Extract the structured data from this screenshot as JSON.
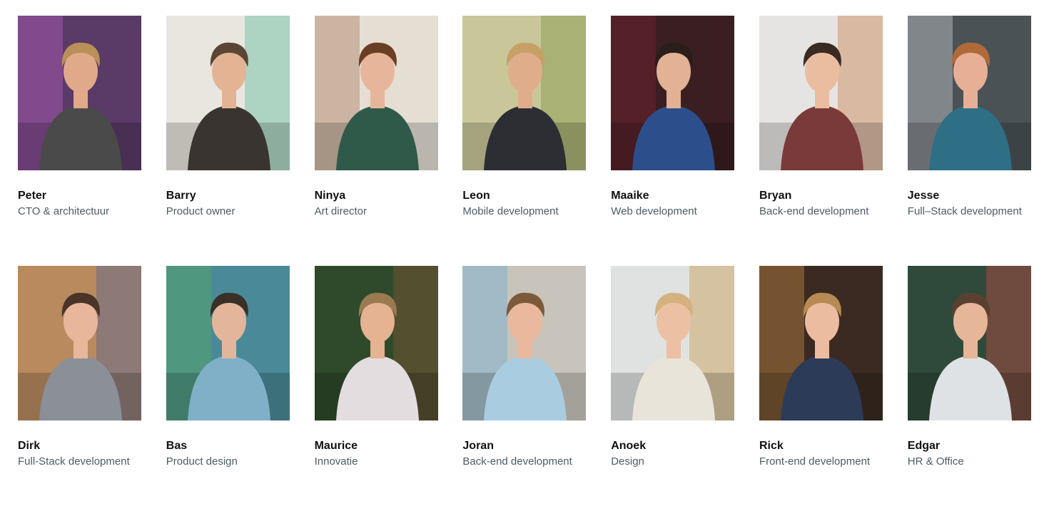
{
  "team": [
    {
      "name": "Peter",
      "role": "CTO & architectuur",
      "photo": {
        "bg": "#5a3a66",
        "accent": "#c86ad8",
        "shirt": "#4a4a4a",
        "skin": "#e0a98a",
        "hair": "#b89058"
      }
    },
    {
      "name": "Barry",
      "role": "Product owner",
      "photo": {
        "bg": "#e9e6df",
        "accent": "#3fae8c",
        "shirt": "#3a3430",
        "skin": "#e3b394",
        "hair": "#5b4534"
      }
    },
    {
      "name": "Ninya",
      "role": "Art director",
      "photo": {
        "bg": "#e5ded3",
        "accent": "#9c6a48",
        "shirt": "#2f5a4a",
        "skin": "#e7b69a",
        "hair": "#6a3e24"
      }
    },
    {
      "name": "Leon",
      "role": "Mobile development",
      "photo": {
        "bg": "#c9c79a",
        "accent": "#6c8a2e",
        "shirt": "#2c2e33",
        "skin": "#e0ad8a",
        "hair": "#c7a066"
      }
    },
    {
      "name": "Maaike",
      "role": "Web development",
      "photo": {
        "bg": "#3a1e22",
        "accent": "#8a2434",
        "shirt": "#2c4f8c",
        "skin": "#e3b194",
        "hair": "#2a1e1a"
      }
    },
    {
      "name": "Bryan",
      "role": "Back-end development",
      "photo": {
        "bg": "#e6e4e2",
        "accent": "#c46a2a",
        "shirt": "#7a3a3a",
        "skin": "#ebbda0",
        "hair": "#3a2a22"
      }
    },
    {
      "name": "Jesse",
      "role": "Full–Stack development",
      "photo": {
        "bg": "#4a5256",
        "accent": "#e7e9ea",
        "shirt": "#2f6f86",
        "skin": "#e7b096",
        "hair": "#b06a3a"
      }
    },
    {
      "name": "Dirk",
      "role": "Full-Stack development",
      "photo": {
        "bg": "#b88a5e",
        "accent": "#3c5aa0",
        "shirt": "#8a8f98",
        "skin": "#e8b69a",
        "hair": "#4a3428"
      }
    },
    {
      "name": "Bas",
      "role": "Product design",
      "photo": {
        "bg": "#4a8a98",
        "accent": "#5cae54",
        "shirt": "#7fb0c8",
        "skin": "#e3b69c",
        "hair": "#3a3028"
      }
    },
    {
      "name": "Maurice",
      "role": "Innovatie",
      "photo": {
        "bg": "#2e4a2a",
        "accent": "#9a5a3a",
        "shirt": "#e4dde0",
        "skin": "#e5b292",
        "hair": "#9a7a50"
      }
    },
    {
      "name": "Joran",
      "role": "Back-end development",
      "photo": {
        "bg": "#c8c4bc",
        "accent": "#59a8d8",
        "shirt": "#a9cce0",
        "skin": "#eab89c",
        "hair": "#7a5a3a"
      }
    },
    {
      "name": "Anoek",
      "role": "Design",
      "photo": {
        "bg": "#dfe2e0",
        "accent": "#c48828",
        "shirt": "#e9e4da",
        "skin": "#ecc0a2",
        "hair": "#d3b280"
      }
    },
    {
      "name": "Rick",
      "role": "Front-end development",
      "photo": {
        "bg": "#3a2a22",
        "accent": "#e8a04a",
        "shirt": "#2c3c58",
        "skin": "#ecbca0",
        "hair": "#b88a54"
      }
    },
    {
      "name": "Edgar",
      "role": "HR & Office",
      "photo": {
        "bg": "#2f4a3a",
        "accent": "#e84a4a",
        "shirt": "#dfe2e4",
        "skin": "#e6b698",
        "hair": "#5a4030"
      }
    }
  ]
}
